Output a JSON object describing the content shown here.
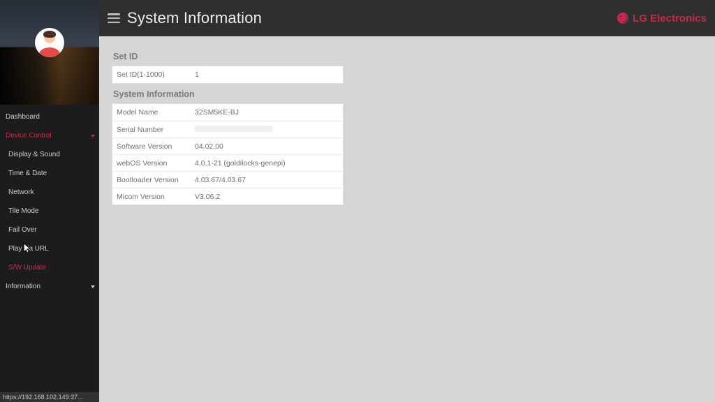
{
  "brand": {
    "text": "LG Electronics"
  },
  "header": {
    "title": "System Information"
  },
  "sidebar": {
    "items": [
      {
        "label": "Dashboard",
        "level": 1,
        "active": false,
        "caret": false
      },
      {
        "label": "Device Control",
        "level": 1,
        "active": true,
        "caret": true
      },
      {
        "label": "Display & Sound",
        "level": 2,
        "active": false,
        "caret": false
      },
      {
        "label": "Time & Date",
        "level": 2,
        "active": false,
        "caret": false
      },
      {
        "label": "Network",
        "level": 2,
        "active": false,
        "caret": false
      },
      {
        "label": "Tile Mode",
        "level": 2,
        "active": false,
        "caret": false
      },
      {
        "label": "Fail Over",
        "level": 2,
        "active": false,
        "caret": false
      },
      {
        "label": "Play via URL",
        "level": 2,
        "active": false,
        "caret": false
      },
      {
        "label": "S/W Update",
        "level": 2,
        "active": true,
        "caret": false
      },
      {
        "label": "Information",
        "level": 1,
        "active": false,
        "caret": true
      }
    ]
  },
  "sections": {
    "set_id": {
      "title": "Set ID",
      "row_label": "Set ID(1-1000)",
      "row_value": "1"
    },
    "system_info": {
      "title": "System Information",
      "rows": [
        {
          "k": "Model Name",
          "v": "32SM5KE-BJ"
        },
        {
          "k": "Serial Number",
          "v": ""
        },
        {
          "k": "Software Version",
          "v": "04.02.00"
        },
        {
          "k": "webOS Version",
          "v": "4.0.1-21 (goldilocks-genepi)"
        },
        {
          "k": "Bootloader Version",
          "v": "4.03.67/4.03.67"
        },
        {
          "k": "Micom Version",
          "v": "V3.06.2"
        }
      ]
    }
  },
  "statusbar": {
    "text": "https://192.168.102.149:37…"
  }
}
